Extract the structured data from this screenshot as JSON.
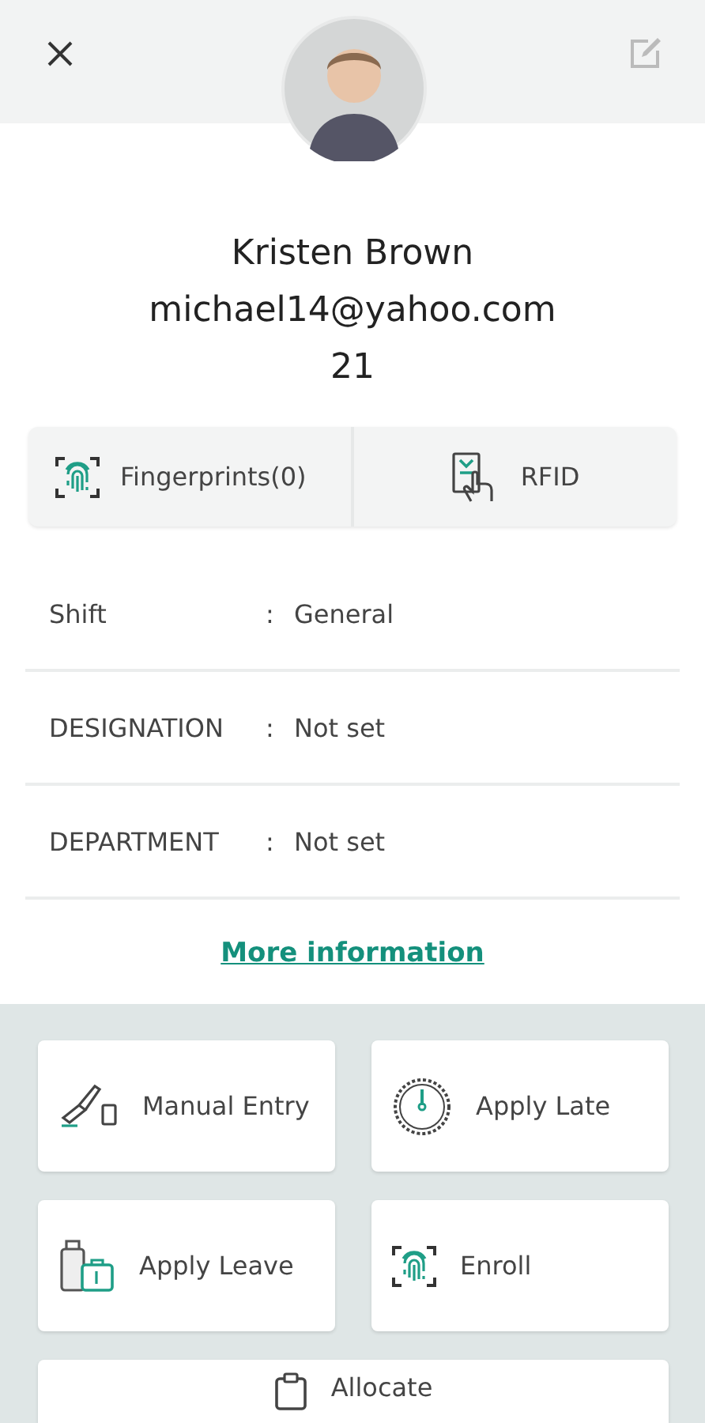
{
  "profile": {
    "name": "Kristen Brown",
    "email": "michael14@yahoo.com",
    "employee_id": "21"
  },
  "credentials": [
    {
      "kind": "fingerprint",
      "label": "Fingerprints(0)"
    },
    {
      "kind": "rfid",
      "label": "RFID"
    }
  ],
  "details": [
    {
      "label": "Shift",
      "separator": ":",
      "value": "General"
    },
    {
      "label": "DESIGNATION",
      "separator": ":",
      "value": "Not set"
    },
    {
      "label": "DEPARTMENT",
      "separator": ":",
      "value": "Not set"
    }
  ],
  "more_link": "More information",
  "actions": [
    {
      "kind": "manual",
      "label": "Manual Entry"
    },
    {
      "kind": "late",
      "label": "Apply Late"
    },
    {
      "kind": "leave",
      "label": "Apply Leave"
    },
    {
      "kind": "enroll",
      "label": "Enroll"
    },
    {
      "kind": "allocate",
      "label": "Allocate"
    }
  ]
}
